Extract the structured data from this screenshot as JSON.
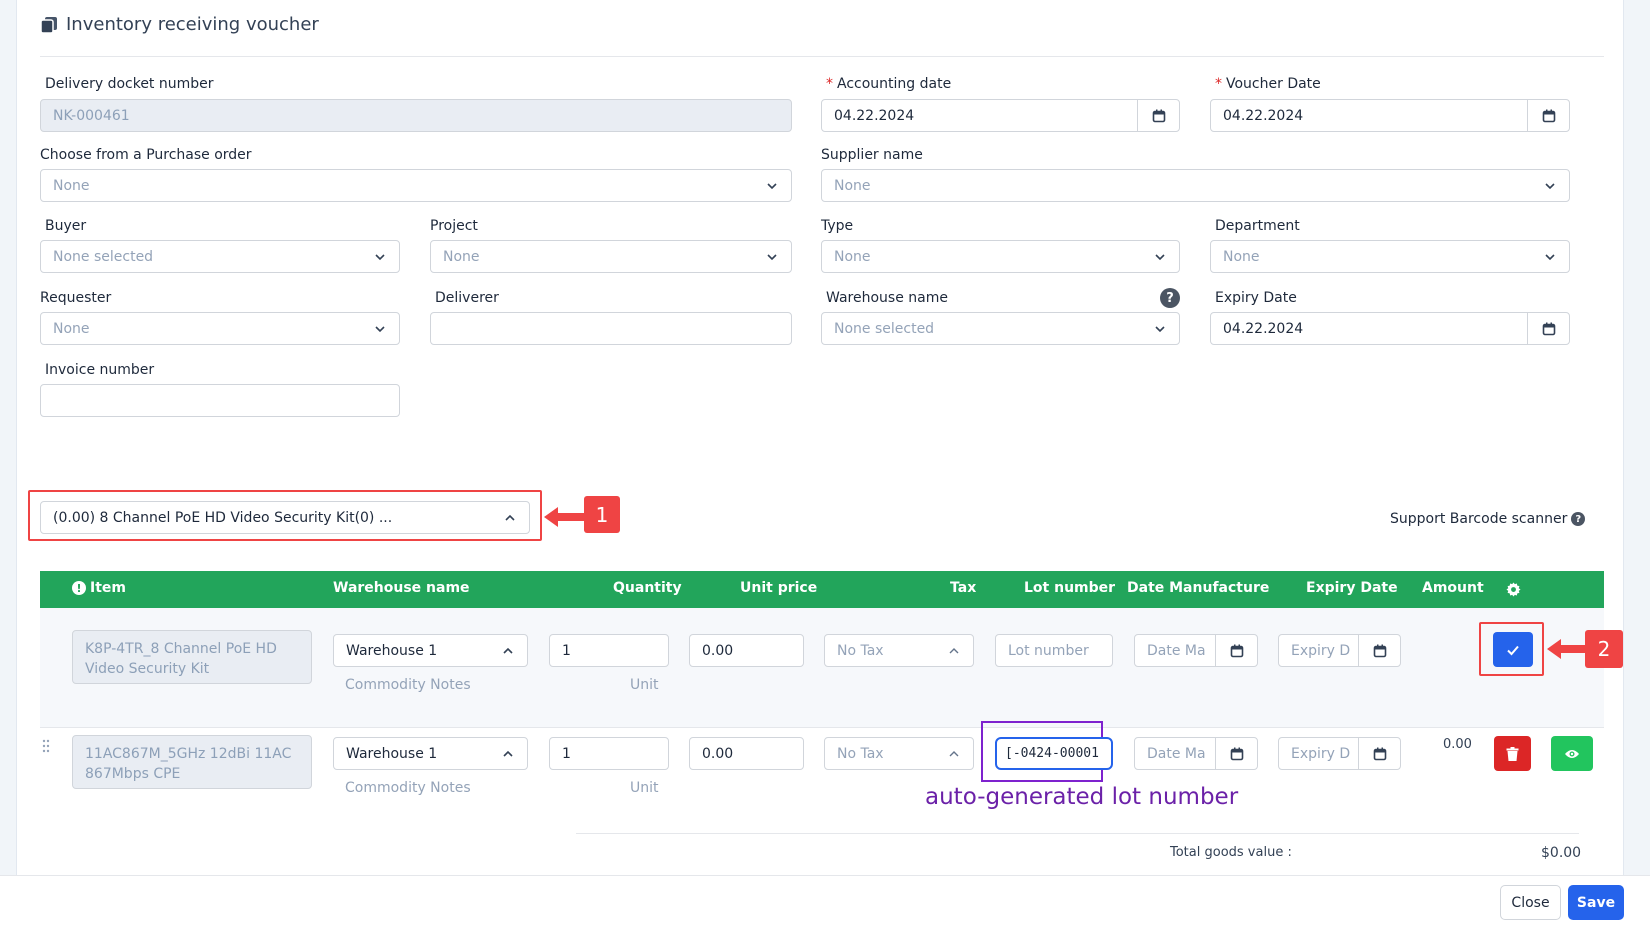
{
  "title": "Inventory receiving voucher",
  "fields": {
    "delivery_docket": {
      "label": "Delivery docket number",
      "value": "NK-000461"
    },
    "accounting_date": {
      "label": "Accounting date",
      "value": "04.22.2024"
    },
    "voucher_date": {
      "label": "Voucher Date",
      "value": "04.22.2024"
    },
    "purchase_order": {
      "label": "Choose from a Purchase order",
      "value": "None"
    },
    "supplier_name": {
      "label": "Supplier name",
      "value": "None"
    },
    "buyer": {
      "label": "Buyer",
      "value": "None selected"
    },
    "project": {
      "label": "Project",
      "value": "None"
    },
    "type": {
      "label": "Type",
      "value": "None"
    },
    "department": {
      "label": "Department",
      "value": "None"
    },
    "requester": {
      "label": "Requester",
      "value": "None"
    },
    "deliverer": {
      "label": "Deliverer",
      "value": ""
    },
    "warehouse_name": {
      "label": "Warehouse name",
      "value": "None selected"
    },
    "expiry_date": {
      "label": "Expiry Date",
      "value": "04.22.2024"
    },
    "invoice_number": {
      "label": "Invoice number",
      "value": ""
    }
  },
  "item_select": {
    "value": "(0.00) 8 Channel PoE HD Video Security Kit(0) ..."
  },
  "barcode_label": "Support Barcode scanner",
  "table": {
    "headers": {
      "item": "Item",
      "warehouse": "Warehouse name",
      "quantity": "Quantity",
      "unit_price": "Unit price",
      "tax": "Tax",
      "lot_number": "Lot number",
      "date_manufacture": "Date Manufacture",
      "expiry_date": "Expiry Date",
      "amount": "Amount"
    },
    "rows": [
      {
        "item": "K8P-4TR_8 Channel PoE HD Video Security Kit",
        "warehouse": "Warehouse 1",
        "commodity_notes": "Commodity Notes",
        "quantity": "1",
        "unit": "Unit",
        "unit_price": "0.00",
        "tax": "No Tax",
        "lot_placeholder": "Lot number",
        "lot_value": "",
        "date_ma_placeholder": "Date Ma",
        "expiry_placeholder": "Expiry D",
        "amount": ""
      },
      {
        "item": "11AC867M_5GHz 12dBi 11AC 867Mbps CPE",
        "warehouse": "Warehouse 1",
        "commodity_notes": "Commodity Notes",
        "quantity": "1",
        "unit": "Unit",
        "unit_price": "0.00",
        "tax": "No Tax",
        "lot_placeholder": "",
        "lot_value": "[-0424-00001",
        "date_ma_placeholder": "Date Ma",
        "expiry_placeholder": "Expiry D",
        "amount": "0.00"
      }
    ]
  },
  "total": {
    "label": "Total goods value :",
    "value": "$0.00"
  },
  "annotations": {
    "badge1": "1",
    "badge2": "2",
    "lot_note": "auto-generated lot number"
  },
  "footer": {
    "close": "Close",
    "save": "Save"
  },
  "icons": {
    "title": "clipboard-icon",
    "calendar": "calendar-icon",
    "chevron": "chevron-down-icon",
    "help": "question-circle-icon",
    "gear": "gear-icon",
    "check": "check-icon",
    "trash": "trash-icon",
    "eye": "eye-icon"
  },
  "colors": {
    "header_green": "#22a55b",
    "primary_blue": "#2563eb",
    "danger_red": "#dc2626",
    "success_green": "#22c55e",
    "annotation_red": "#ef4444",
    "annotation_purple": "#7e22ce"
  }
}
